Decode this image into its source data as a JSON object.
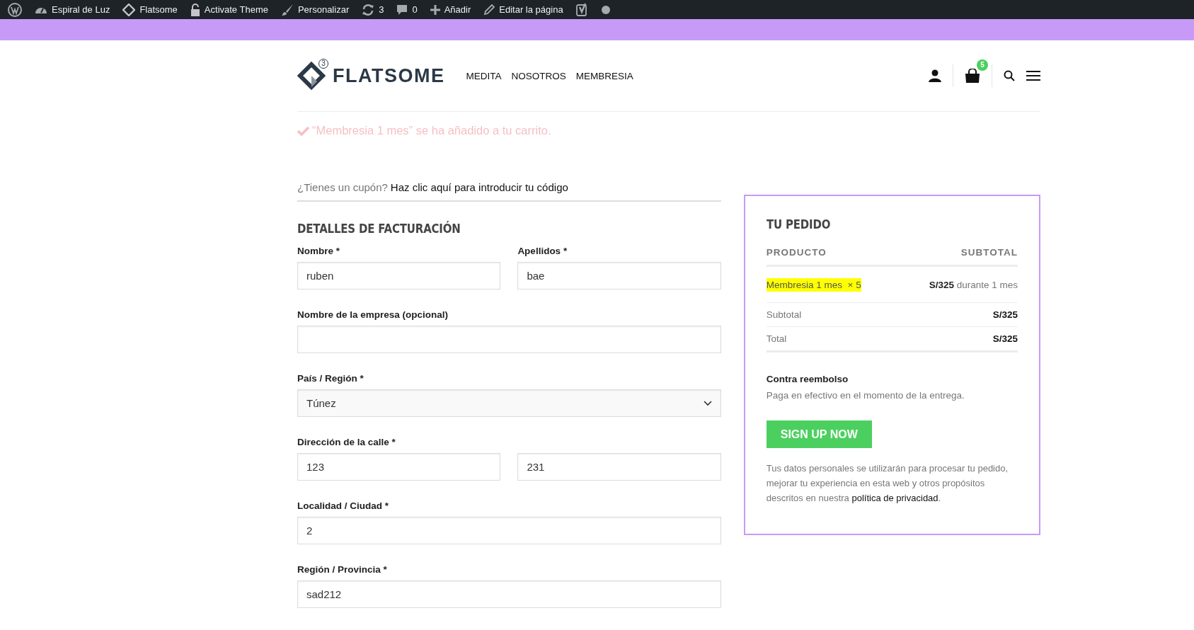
{
  "admin_bar": {
    "items": [
      {
        "kind": "wordpress"
      },
      {
        "kind": "dashboard",
        "label": "Espiral de Luz"
      },
      {
        "kind": "diamond",
        "label": "Flatsome"
      },
      {
        "kind": "lock",
        "label": "Activate Theme"
      },
      {
        "kind": "brush",
        "label": "Personalizar"
      },
      {
        "kind": "refresh",
        "label": "3"
      },
      {
        "kind": "comment",
        "label": "0"
      },
      {
        "kind": "plus",
        "label": "Añadir"
      },
      {
        "kind": "pencil",
        "label": "Editar la página"
      },
      {
        "kind": "yoast"
      },
      {
        "kind": "dot"
      }
    ]
  },
  "header": {
    "logo": {
      "text": "FLATSOME",
      "superscript": "3"
    },
    "nav": [
      "MEDITA",
      "NOSOTROS",
      "MEMBRESIA"
    ],
    "cart_count": "5"
  },
  "notice": "“Membresia 1 mes” se ha añadido a tu carrito.",
  "coupon": {
    "question": "¿Tienes un cupón?",
    "link": "Haz clic aquí para introducir tu código"
  },
  "billing": {
    "title": "DETALLES DE FACTURACIÓN",
    "rows": [
      {
        "fields": [
          {
            "label": "Nombre *",
            "kind": "text",
            "value": "ruben"
          },
          {
            "label": "Apellidos *",
            "kind": "text",
            "value": "bae"
          }
        ]
      },
      {
        "fields": [
          {
            "label": "Nombre de la empresa (opcional)",
            "kind": "text"
          }
        ]
      },
      {
        "fields": [
          {
            "label": "País / Región *",
            "kind": "select",
            "value": "Túnez"
          }
        ]
      },
      {
        "fields": [
          {
            "label": "Dirección de la calle *",
            "kind": "text",
            "value": "123"
          },
          {
            "kind": "text",
            "value": "231"
          }
        ]
      },
      {
        "fields": [
          {
            "label": "Localidad / Ciudad *",
            "kind": "text",
            "value": "2"
          }
        ]
      },
      {
        "fields": [
          {
            "label": "Región / Provincia *",
            "kind": "text",
            "value": "sad212"
          }
        ]
      }
    ]
  },
  "order": {
    "title": "TU PEDIDO",
    "columns": [
      "PRODUCTO",
      "SUBTOTAL"
    ],
    "items": [
      {
        "name": "Membresia 1 mes",
        "quantity": "× 5",
        "price": "S/325",
        "period": "durante 1 mes",
        "highlighted": true
      }
    ],
    "totals": [
      {
        "label": "Subtotal",
        "value": "S/325"
      },
      {
        "label": "Total",
        "value": "S/325"
      }
    ],
    "payment": {
      "title": "Contra reembolso",
      "description": "Paga en efectivo en el momento de la entrega."
    },
    "button": "SIGN UP NOW",
    "privacy_text": "Tus datos personales se utilizarán para procesar tu pedido, mejorar tu experiencia en esta web y otros propósitos descritos en nuestra",
    "privacy_link": "política de privacidad",
    "privacy_end": "."
  }
}
